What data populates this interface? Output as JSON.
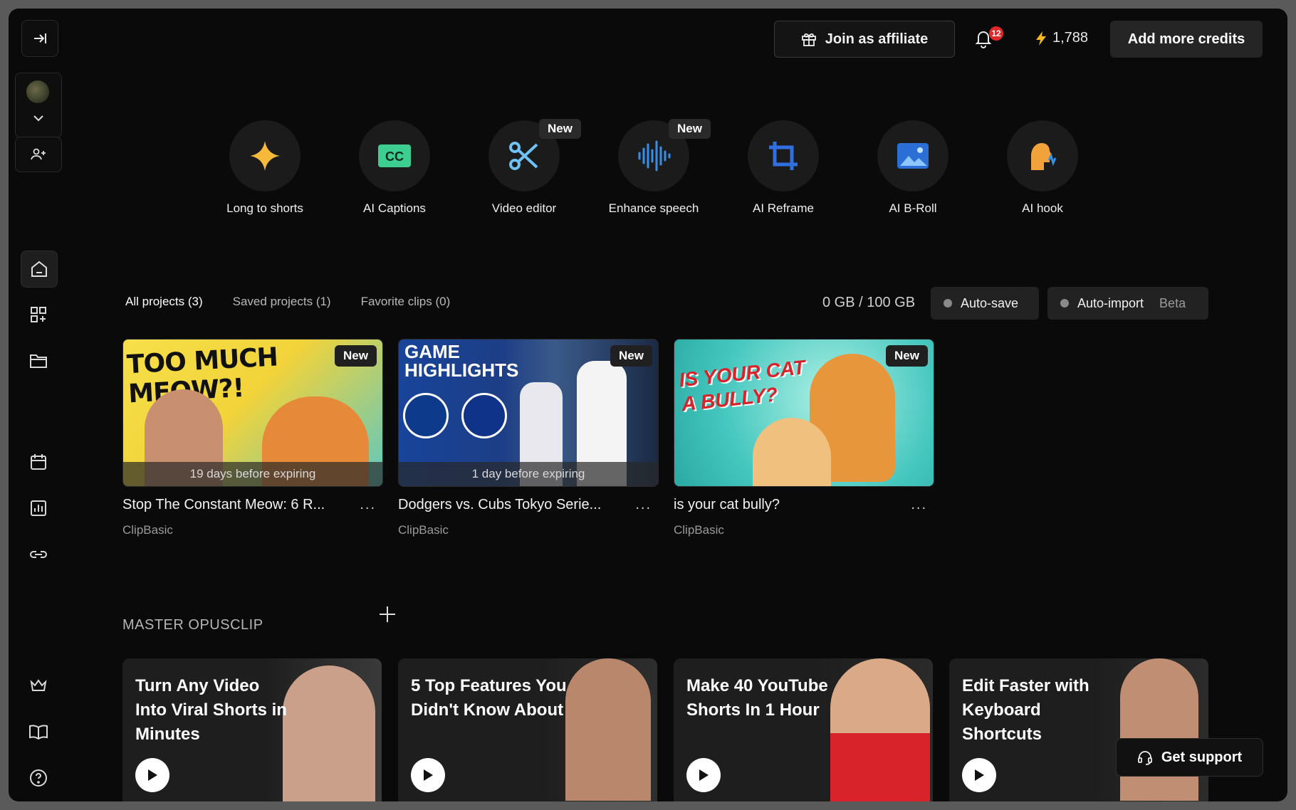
{
  "header": {
    "affiliate_label": "Join as affiliate",
    "notification_count": "12",
    "credits": "1,788",
    "add_credits_label": "Add more credits"
  },
  "tools": [
    {
      "label": "Long to shorts",
      "new": ""
    },
    {
      "label": "AI Captions",
      "new": ""
    },
    {
      "label": "Video editor",
      "new": "New"
    },
    {
      "label": "Enhance speech",
      "new": "New"
    },
    {
      "label": "AI Reframe",
      "new": ""
    },
    {
      "label": "AI B-Roll",
      "new": ""
    },
    {
      "label": "AI hook",
      "new": ""
    }
  ],
  "tabs": {
    "all": "All projects (3)",
    "saved": "Saved projects (1)",
    "favorite": "Favorite clips (0)"
  },
  "storage": "0 GB / 100 GB",
  "auto_save": "Auto-save",
  "auto_import": "Auto-import",
  "beta": "Beta",
  "projects": [
    {
      "title": "Stop The Constant Meow: 6 R...",
      "owner": "ClipBasic",
      "badge": "New",
      "expire": "19 days before expiring",
      "thumb_text": "TOO MUCH MEOW?!"
    },
    {
      "title": "Dodgers vs. Cubs Tokyo Serie...",
      "owner": "ClipBasic",
      "badge": "New",
      "expire": "1 day before expiring",
      "thumb_text": "GAME HIGHLIGHTS"
    },
    {
      "title": "is your cat bully?",
      "owner": "ClipBasic",
      "badge": "New",
      "expire": "",
      "thumb_text": "IS YOUR CAT A BULLY?"
    }
  ],
  "more_label": "...",
  "master": {
    "title": "MASTER OPUSCLIP",
    "videos": [
      {
        "title": "Turn Any Video Into Viral Shorts in Minutes"
      },
      {
        "title": "5 Top Features You Didn't Know About"
      },
      {
        "title": "Make 40 YouTube Shorts In 1 Hour"
      },
      {
        "title": "Edit Faster with Keyboard Shortcuts"
      }
    ]
  },
  "support_label": "Get support"
}
